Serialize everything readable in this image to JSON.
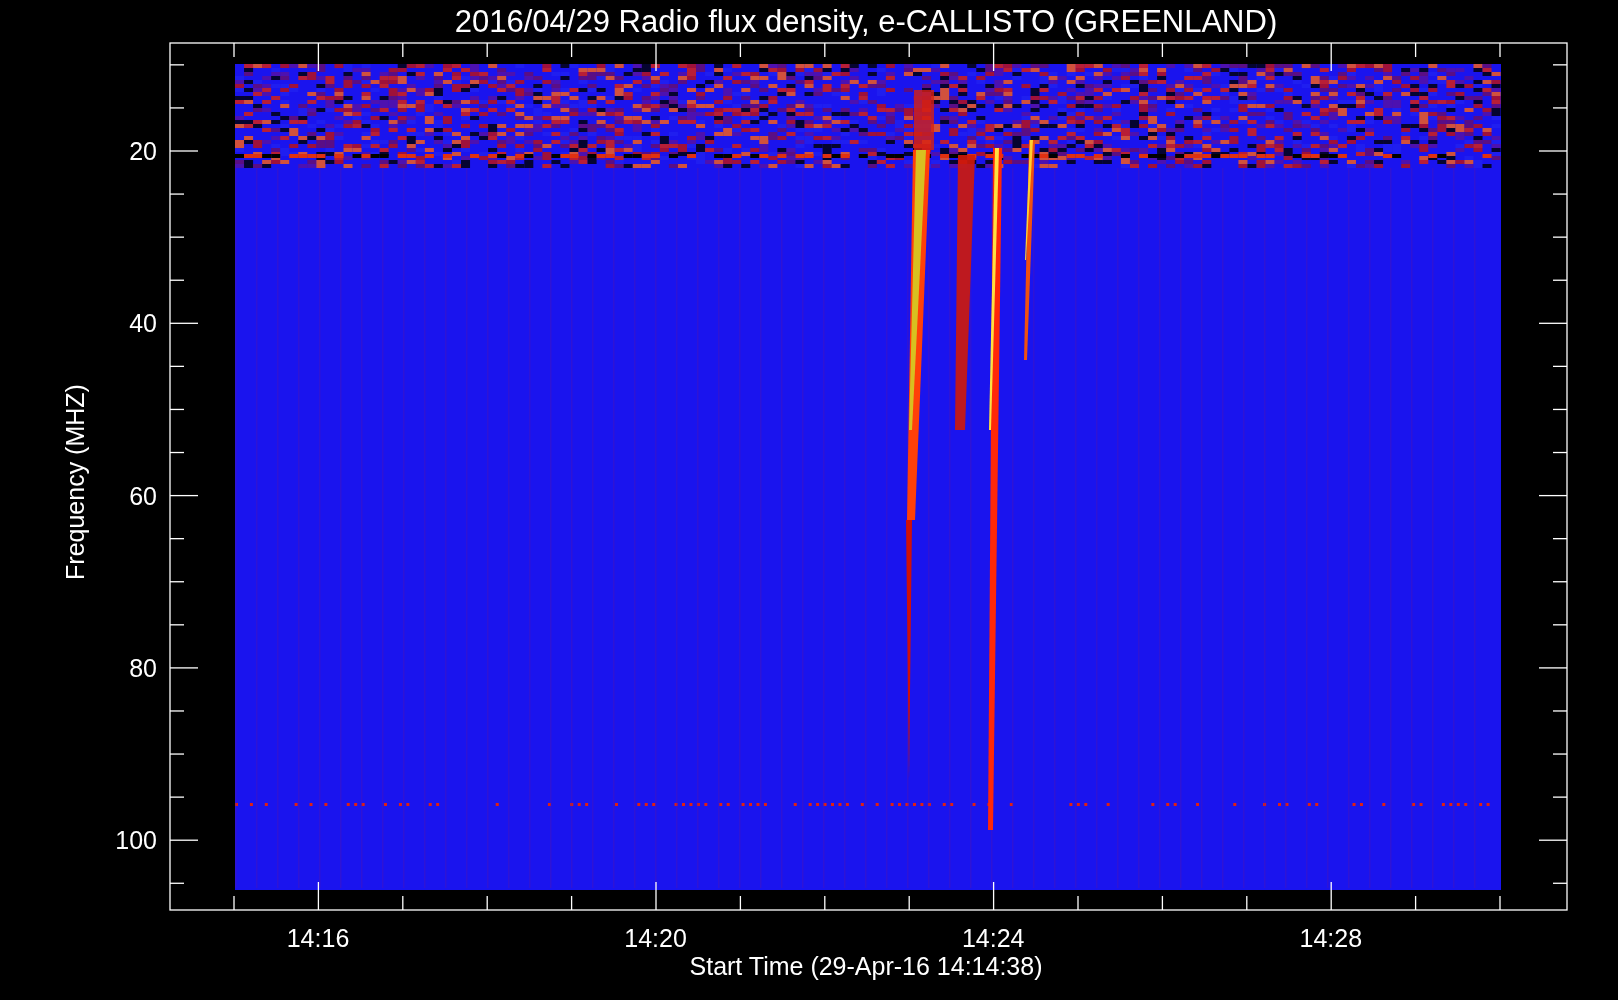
{
  "plot": {
    "title": "2016/04/29  Radio flux density, e-CALLISTO (GREENLAND)",
    "ylabel": "Frequency (MHZ)",
    "xlabel": "Start Time (29-Apr-16 14:14:38)",
    "yticks": [
      "20",
      "40",
      "60",
      "80",
      "100"
    ],
    "xticks": [
      "14:16",
      "14:20",
      "14:24",
      "14:28"
    ]
  }
}
